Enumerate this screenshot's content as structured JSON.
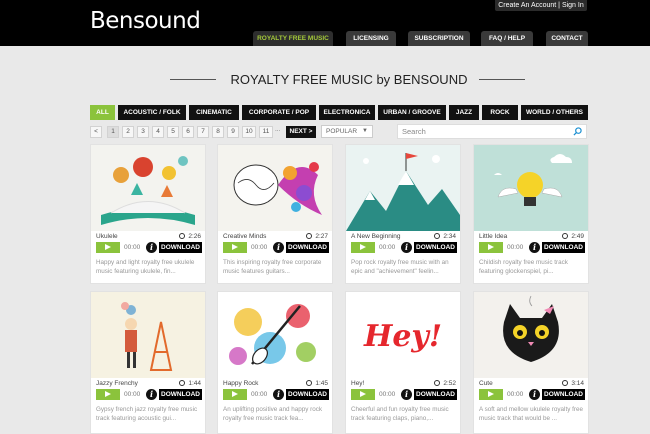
{
  "header": {
    "logo": "Bensound",
    "account_link": "Create An Account | Sign In",
    "nav": [
      "ROYALTY FREE MUSIC",
      "LICENSING",
      "SUBSCRIPTION",
      "FAQ / HELP",
      "CONTACT"
    ]
  },
  "page_title": "ROYALTY FREE MUSIC by BENSOUND",
  "filters": [
    "ALL",
    "ACOUSTIC / FOLK",
    "CINEMATIC",
    "CORPORATE / POP",
    "ELECTRONICA",
    "URBAN / GROOVE",
    "JAZZ",
    "ROCK",
    "WORLD / OTHERS"
  ],
  "pagination": {
    "prev": "<",
    "pages": [
      "1",
      "2",
      "3",
      "4",
      "5",
      "6",
      "7",
      "8",
      "9",
      "10",
      "11"
    ],
    "ellipsis": "...",
    "next": "NEXT >",
    "current": "1"
  },
  "sort": {
    "value": "POPULAR"
  },
  "search": {
    "placeholder": "Search"
  },
  "player": {
    "time": "00:00",
    "download": "DOWNLOAD",
    "info": "i"
  },
  "tracks": [
    {
      "name": "Ukulele",
      "duration": "2:26",
      "desc": "Happy and light royalty free ukulele music featuring ukulele, fin..."
    },
    {
      "name": "Creative Minds",
      "duration": "2:27",
      "desc": "This inspiring royalty free corporate music features guitars..."
    },
    {
      "name": "A New Beginning",
      "duration": "2:34",
      "desc": "Pop rock royalty free music with an epic and \"achievement\" feelin..."
    },
    {
      "name": "Little Idea",
      "duration": "2:49",
      "desc": "Childish royalty free music track featuring glockenspiel, pi..."
    },
    {
      "name": "Jazzy Frenchy",
      "duration": "1:44",
      "desc": "Gypsy french jazz royalty free music track featuring acoustic gui..."
    },
    {
      "name": "Happy Rock",
      "duration": "1:45",
      "desc": "An uplifting positive and happy rock royalty free music track fea..."
    },
    {
      "name": "Hey!",
      "duration": "2:52",
      "desc": "Cheerful and fun royalty free music track featuring claps, piano,..."
    },
    {
      "name": "Cute",
      "duration": "3:14",
      "desc": "A soft and mellow ukulele royalty free music track that would be ..."
    }
  ],
  "art_text": {
    "hey": "Hey!"
  },
  "colors": {
    "accent": "#8bc33c",
    "header": "#000000",
    "background": "#e9e9e9"
  }
}
